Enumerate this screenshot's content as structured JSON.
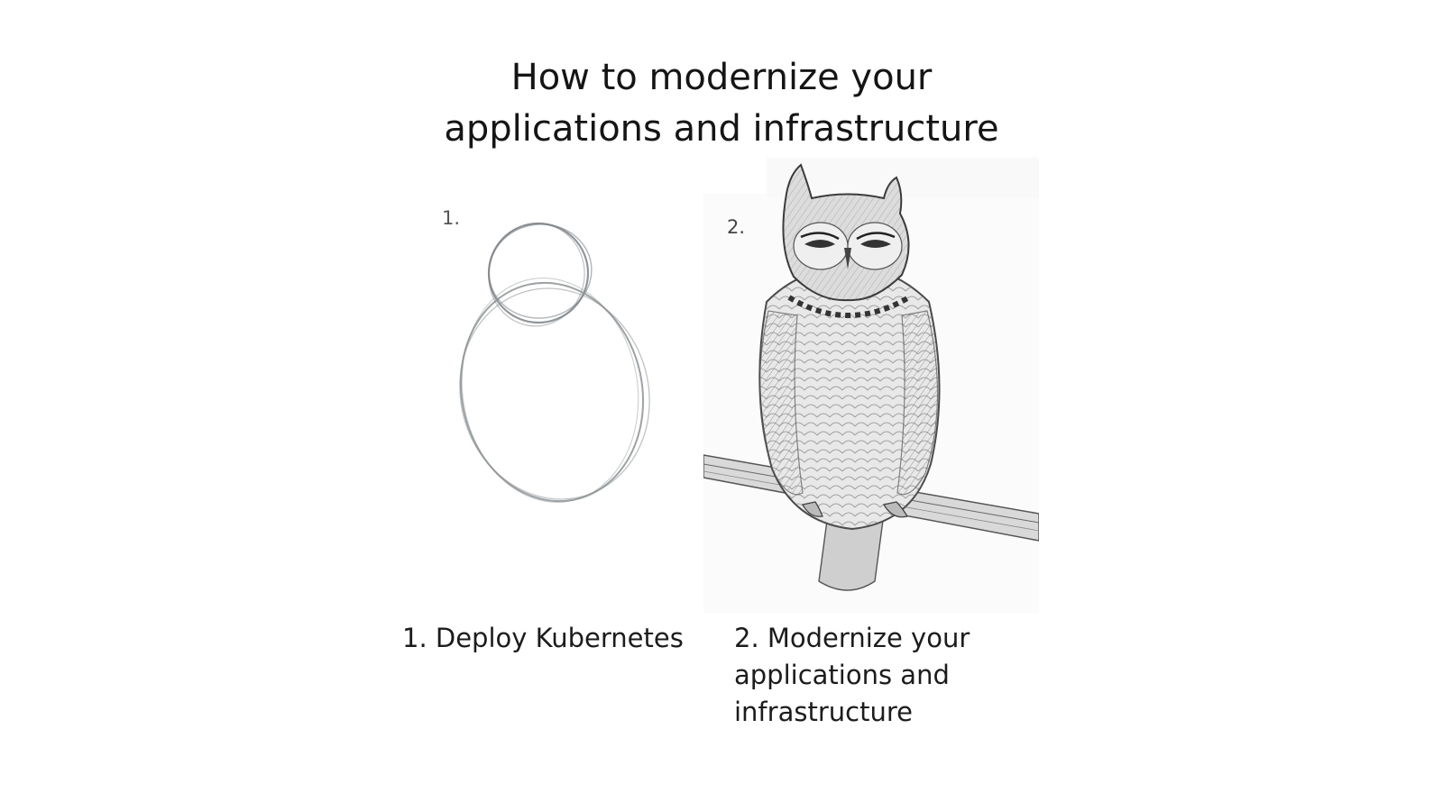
{
  "slide": {
    "title_lines": [
      "How to modernize your",
      "applications and infrastructure"
    ]
  },
  "panels": [
    {
      "number_label": "1.",
      "drawing": "pencil-circles-sketch",
      "caption_lines": [
        "1. Deploy Kubernetes"
      ]
    },
    {
      "number_label": "2.",
      "drawing": "detailed-owl-drawing",
      "caption_lines": [
        "2. Modernize your",
        "applications and",
        "infrastructure"
      ]
    }
  ],
  "colors": {
    "background": "#ffffff",
    "text": "#1a1a1a",
    "pencil": "#8c9295"
  }
}
